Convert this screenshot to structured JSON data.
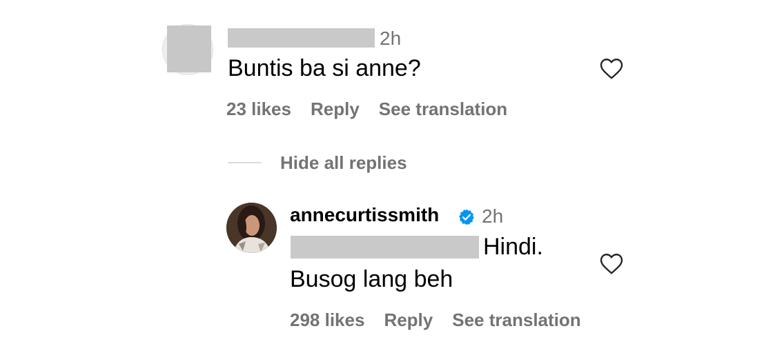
{
  "comment": {
    "timestamp": "2h",
    "text": "Buntis ba si anne?",
    "likes": "23 likes",
    "reply_label": "Reply",
    "translate_label": "See translation"
  },
  "replies_toggle": {
    "label": "Hide all replies"
  },
  "reply": {
    "username": "annecurtissmith",
    "timestamp": "2h",
    "text_line1": "Hindi.",
    "text_line2": "Busog lang beh",
    "likes": "298 likes",
    "reply_label": "Reply",
    "translate_label": "See translation"
  },
  "icons": {
    "like": "heart-outline-icon",
    "verified": "verified-badge-icon"
  },
  "colors": {
    "text_primary": "#000000",
    "text_secondary": "#737373",
    "verified": "#0095f6",
    "redaction": "#c9c9c9"
  }
}
